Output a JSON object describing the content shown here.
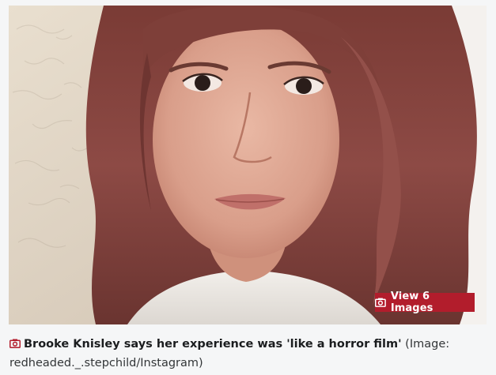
{
  "photo": {
    "alt": "Woman with wavy reddish-brown hair looking at the camera"
  },
  "gallery": {
    "label": "View 6 Images",
    "icon": "camera-icon"
  },
  "caption": {
    "icon": "camera-icon",
    "text": "Brooke Knisley says her experience was 'like a horror film'",
    "credit": "(Image: redheaded._.stepchild/Instagram)"
  },
  "colors": {
    "accent": "#b21d2c",
    "background": "#f5f6f7",
    "caption_text": "#222426"
  }
}
